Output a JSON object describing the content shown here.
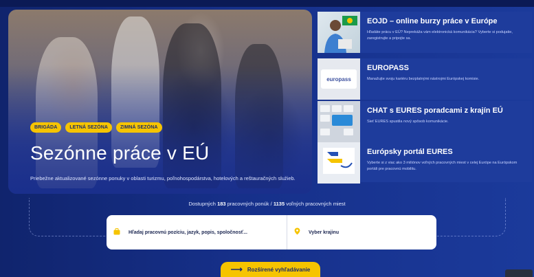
{
  "hero": {
    "tags": [
      "BRIGÁDA",
      "LETNÁ SEZÓNA",
      "ZIMNÁ SEZÓNA"
    ],
    "title": "Sezónne práce v EÚ",
    "description": "Priebežne aktualizované sezónne ponuky v oblasti turizmu, poľnohospodárstva, hotelových a reštauračných služieb."
  },
  "cards": [
    {
      "title": "EOJD – online burzy práce v Európe",
      "text": "Hľadáte prácu v EÚ? Neprekáža vám elektronická komunikácia? Vyberte si podujatie, zaregistrujte a pripojte sa.",
      "thumb_icon": "man-with-flag-icon"
    },
    {
      "title": "EUROPASS",
      "text": "Manažujte svoju kariéru bezplatnými nástrojmi Európskej komisie.",
      "thumb_label": "europass",
      "thumb_icon": "europass-logo-icon"
    },
    {
      "title": "CHAT s EURES poradcami z krajín EÚ",
      "text": "Sieť EURES spustila nový spôsob komunikácie.",
      "thumb_icon": "keyboard-chat-icon"
    },
    {
      "title": "Európsky portál EURES",
      "text": "Vyberte si z viac ako 3 miliónov voľných pracovných miest v celej Európe na Európskom portáli pre pracovnú mobilitu.",
      "thumb_icon": "eures-logo-icon"
    }
  ],
  "stats": {
    "prefix": "Dostupných",
    "offers": "183",
    "offers_label": "pracovných ponúk",
    "separator": "/",
    "positions": "1135",
    "positions_label": "voľných pracovných miest"
  },
  "search": {
    "query_placeholder": "Hľadaj pracovnú pozíciu, jazyk, popis, spoločnosť...",
    "region_placeholder": "Vyber krajinu",
    "query_icon": "briefcase-icon",
    "region_icon": "location-pin-icon"
  },
  "advanced_search": {
    "label": "Rozšírené vyhľadávanie",
    "icon": "arrow-right-icon"
  },
  "colors": {
    "accent": "#f6c400",
    "background": "#16308a",
    "card": "#1e3c9c"
  }
}
